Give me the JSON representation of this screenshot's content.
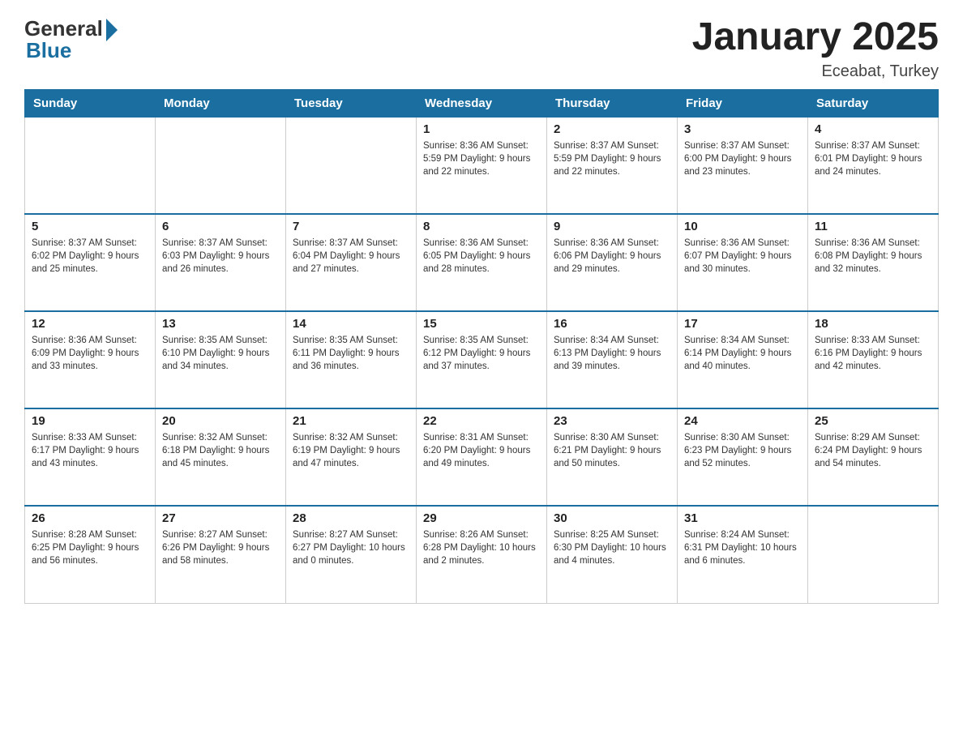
{
  "logo": {
    "general": "General",
    "blue": "Blue"
  },
  "title": "January 2025",
  "subtitle": "Eceabat, Turkey",
  "days": [
    "Sunday",
    "Monday",
    "Tuesday",
    "Wednesday",
    "Thursday",
    "Friday",
    "Saturday"
  ],
  "weeks": [
    [
      {
        "day": "",
        "info": ""
      },
      {
        "day": "",
        "info": ""
      },
      {
        "day": "",
        "info": ""
      },
      {
        "day": "1",
        "info": "Sunrise: 8:36 AM\nSunset: 5:59 PM\nDaylight: 9 hours\nand 22 minutes."
      },
      {
        "day": "2",
        "info": "Sunrise: 8:37 AM\nSunset: 5:59 PM\nDaylight: 9 hours\nand 22 minutes."
      },
      {
        "day": "3",
        "info": "Sunrise: 8:37 AM\nSunset: 6:00 PM\nDaylight: 9 hours\nand 23 minutes."
      },
      {
        "day": "4",
        "info": "Sunrise: 8:37 AM\nSunset: 6:01 PM\nDaylight: 9 hours\nand 24 minutes."
      }
    ],
    [
      {
        "day": "5",
        "info": "Sunrise: 8:37 AM\nSunset: 6:02 PM\nDaylight: 9 hours\nand 25 minutes."
      },
      {
        "day": "6",
        "info": "Sunrise: 8:37 AM\nSunset: 6:03 PM\nDaylight: 9 hours\nand 26 minutes."
      },
      {
        "day": "7",
        "info": "Sunrise: 8:37 AM\nSunset: 6:04 PM\nDaylight: 9 hours\nand 27 minutes."
      },
      {
        "day": "8",
        "info": "Sunrise: 8:36 AM\nSunset: 6:05 PM\nDaylight: 9 hours\nand 28 minutes."
      },
      {
        "day": "9",
        "info": "Sunrise: 8:36 AM\nSunset: 6:06 PM\nDaylight: 9 hours\nand 29 minutes."
      },
      {
        "day": "10",
        "info": "Sunrise: 8:36 AM\nSunset: 6:07 PM\nDaylight: 9 hours\nand 30 minutes."
      },
      {
        "day": "11",
        "info": "Sunrise: 8:36 AM\nSunset: 6:08 PM\nDaylight: 9 hours\nand 32 minutes."
      }
    ],
    [
      {
        "day": "12",
        "info": "Sunrise: 8:36 AM\nSunset: 6:09 PM\nDaylight: 9 hours\nand 33 minutes."
      },
      {
        "day": "13",
        "info": "Sunrise: 8:35 AM\nSunset: 6:10 PM\nDaylight: 9 hours\nand 34 minutes."
      },
      {
        "day": "14",
        "info": "Sunrise: 8:35 AM\nSunset: 6:11 PM\nDaylight: 9 hours\nand 36 minutes."
      },
      {
        "day": "15",
        "info": "Sunrise: 8:35 AM\nSunset: 6:12 PM\nDaylight: 9 hours\nand 37 minutes."
      },
      {
        "day": "16",
        "info": "Sunrise: 8:34 AM\nSunset: 6:13 PM\nDaylight: 9 hours\nand 39 minutes."
      },
      {
        "day": "17",
        "info": "Sunrise: 8:34 AM\nSunset: 6:14 PM\nDaylight: 9 hours\nand 40 minutes."
      },
      {
        "day": "18",
        "info": "Sunrise: 8:33 AM\nSunset: 6:16 PM\nDaylight: 9 hours\nand 42 minutes."
      }
    ],
    [
      {
        "day": "19",
        "info": "Sunrise: 8:33 AM\nSunset: 6:17 PM\nDaylight: 9 hours\nand 43 minutes."
      },
      {
        "day": "20",
        "info": "Sunrise: 8:32 AM\nSunset: 6:18 PM\nDaylight: 9 hours\nand 45 minutes."
      },
      {
        "day": "21",
        "info": "Sunrise: 8:32 AM\nSunset: 6:19 PM\nDaylight: 9 hours\nand 47 minutes."
      },
      {
        "day": "22",
        "info": "Sunrise: 8:31 AM\nSunset: 6:20 PM\nDaylight: 9 hours\nand 49 minutes."
      },
      {
        "day": "23",
        "info": "Sunrise: 8:30 AM\nSunset: 6:21 PM\nDaylight: 9 hours\nand 50 minutes."
      },
      {
        "day": "24",
        "info": "Sunrise: 8:30 AM\nSunset: 6:23 PM\nDaylight: 9 hours\nand 52 minutes."
      },
      {
        "day": "25",
        "info": "Sunrise: 8:29 AM\nSunset: 6:24 PM\nDaylight: 9 hours\nand 54 minutes."
      }
    ],
    [
      {
        "day": "26",
        "info": "Sunrise: 8:28 AM\nSunset: 6:25 PM\nDaylight: 9 hours\nand 56 minutes."
      },
      {
        "day": "27",
        "info": "Sunrise: 8:27 AM\nSunset: 6:26 PM\nDaylight: 9 hours\nand 58 minutes."
      },
      {
        "day": "28",
        "info": "Sunrise: 8:27 AM\nSunset: 6:27 PM\nDaylight: 10 hours\nand 0 minutes."
      },
      {
        "day": "29",
        "info": "Sunrise: 8:26 AM\nSunset: 6:28 PM\nDaylight: 10 hours\nand 2 minutes."
      },
      {
        "day": "30",
        "info": "Sunrise: 8:25 AM\nSunset: 6:30 PM\nDaylight: 10 hours\nand 4 minutes."
      },
      {
        "day": "31",
        "info": "Sunrise: 8:24 AM\nSunset: 6:31 PM\nDaylight: 10 hours\nand 6 minutes."
      },
      {
        "day": "",
        "info": ""
      }
    ]
  ]
}
